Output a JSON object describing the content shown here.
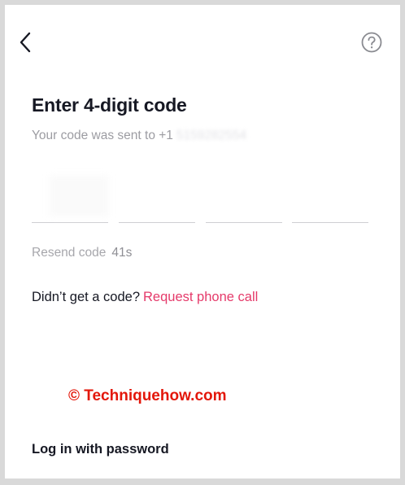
{
  "nav": {
    "back_icon": "chevron-left-icon",
    "help_icon": "question-circle-icon"
  },
  "main": {
    "title": "Enter 4-digit code",
    "subtitle_prefix": "Your code was sent to +1",
    "subtitle_number": "5159282554",
    "code_digits": [
      "",
      "",
      "",
      ""
    ],
    "resend_label": "Resend code",
    "resend_timer": "41s",
    "no_code_text": "Didn’t get a code?",
    "request_call_label": "Request phone call",
    "login_password_label": "Log in with password"
  },
  "watermark": {
    "text": "© Techniquehow.com"
  },
  "colors": {
    "accent": "#e53a6a",
    "watermark": "#e3170a",
    "text_primary": "#161823",
    "text_muted": "#9c9ca2"
  }
}
